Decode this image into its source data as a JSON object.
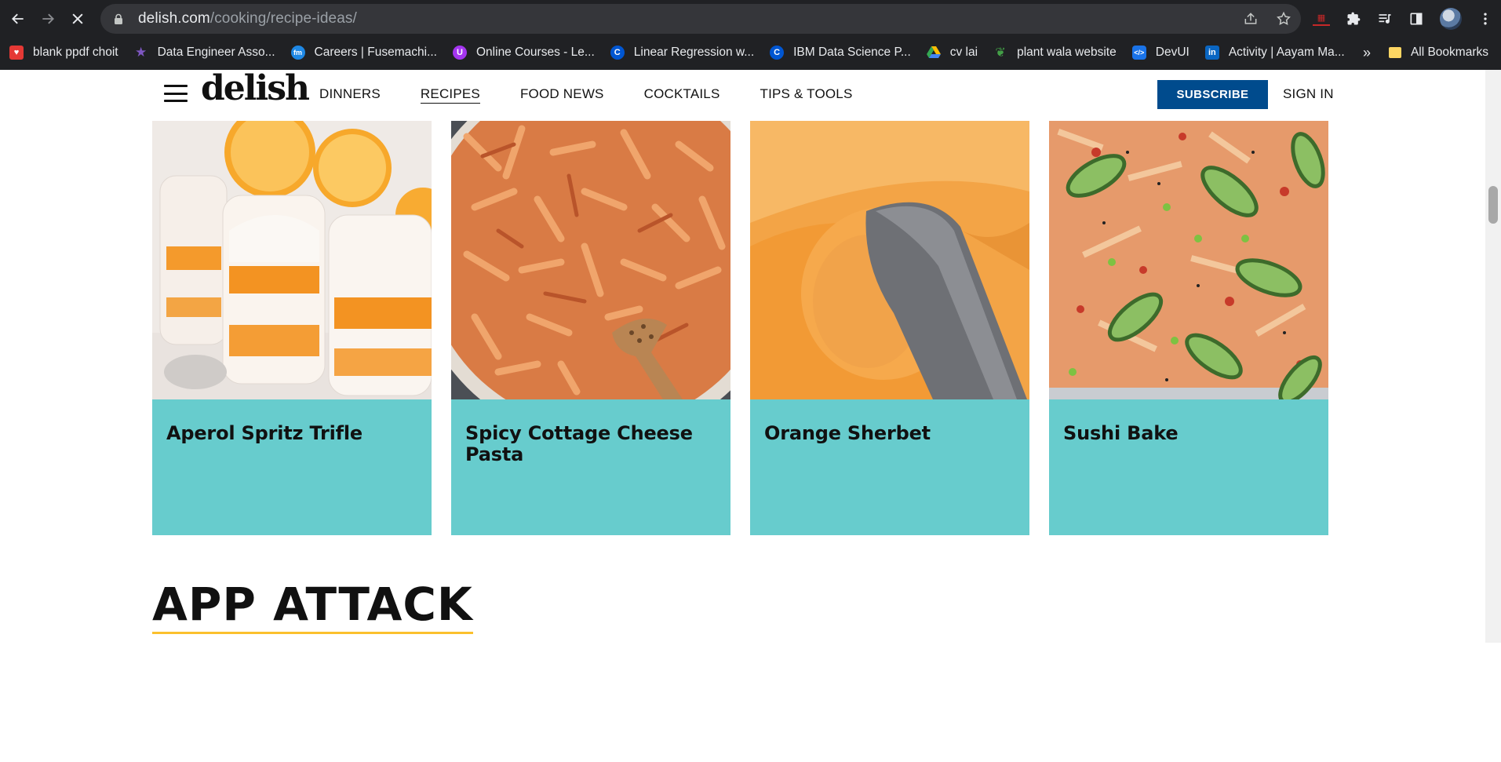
{
  "browser": {
    "url_domain": "delish.com",
    "url_path": "/cooking/recipe-ideas/",
    "bookmarks": [
      {
        "label": "blank ppdf choit",
        "icon": "heart-icon",
        "color": "#e53935"
      },
      {
        "label": "Data Engineer Asso...",
        "icon": "star-badge-icon",
        "color": "#7e57c2"
      },
      {
        "label": "Careers | Fusemachi...",
        "icon": "fusemachines-icon",
        "color": "#1e88e5"
      },
      {
        "label": "Online Courses - Le...",
        "icon": "udemy-icon",
        "color": "#a435f0"
      },
      {
        "label": "Linear Regression w...",
        "icon": "coursera-icon",
        "color": "#0056d2"
      },
      {
        "label": "IBM Data Science P...",
        "icon": "coursera-icon",
        "color": "#0056d2"
      },
      {
        "label": "cv lai",
        "icon": "google-drive-icon",
        "color": "#34a853"
      },
      {
        "label": "plant wala website",
        "icon": "plant-icon",
        "color": "#2e7d32"
      },
      {
        "label": "DevUI",
        "icon": "devui-icon",
        "color": "#1a73e8"
      },
      {
        "label": "Activity | Aayam Ma...",
        "icon": "linkedin-icon",
        "color": "#0a66c2"
      }
    ],
    "bookmarks_more": "»",
    "all_bookmarks": "All Bookmarks"
  },
  "header": {
    "logo": "delish",
    "nav": [
      {
        "label": "DINNERS",
        "active": false
      },
      {
        "label": "RECIPES",
        "active": true
      },
      {
        "label": "FOOD NEWS",
        "active": false
      },
      {
        "label": "COCKTAILS",
        "active": false
      },
      {
        "label": "TIPS & TOOLS",
        "active": false
      }
    ],
    "subscribe": "SUBSCRIBE",
    "signin": "SIGN IN"
  },
  "cards": [
    {
      "title": "Aperol Spritz Trifle"
    },
    {
      "title": "Spicy Cottage Cheese Pasta"
    },
    {
      "title": "Orange Sherbet"
    },
    {
      "title": "Sushi Bake"
    }
  ],
  "section_title": "APP ATTACK",
  "colors": {
    "caption_bg": "#67cccd",
    "subscribe_bg": "#004b8d",
    "section_underline": "#fbc02d"
  }
}
